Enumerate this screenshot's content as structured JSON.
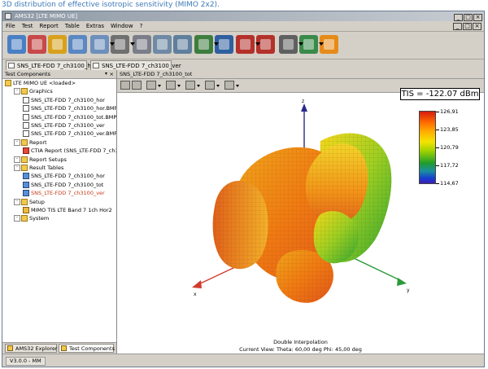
{
  "caption": "3D distribution of effective isotropic sensitivity (MIMO 2x2).",
  "window": {
    "title": "AMS32 [LTE MIMO UE]",
    "controls": [
      "_",
      "□",
      "×"
    ]
  },
  "menu": {
    "items": [
      "File",
      "Test",
      "Report",
      "Table",
      "Extras",
      "Window",
      "?"
    ]
  },
  "toolbar": {
    "buttons": [
      {
        "name": "new-icon",
        "color": "#4a7fc4"
      },
      {
        "name": "chart-icon",
        "color": "#c74949"
      },
      {
        "name": "report-icon",
        "color": "#d8a11c"
      },
      {
        "name": "table-icon",
        "color": "#5b87c2"
      },
      {
        "name": "edit-icon",
        "color": "#6d8fbc"
      },
      {
        "name": "print-icon",
        "color": "#707070"
      },
      {
        "name": "database-icon",
        "color": "#7b7e88"
      },
      {
        "name": "database-save-icon",
        "color": "#6f8aa5"
      },
      {
        "name": "database-refresh-icon",
        "color": "#5f7f9c"
      },
      {
        "name": "run-icon",
        "color": "#3e7d3e"
      },
      {
        "name": "stop-icon",
        "color": "#2f5f9f"
      },
      {
        "name": "record-icon",
        "color": "#b3312a"
      },
      {
        "name": "pause-icon",
        "color": "#b3312a"
      },
      {
        "name": "tools-icon",
        "color": "#606060"
      },
      {
        "name": "setup-icon",
        "color": "#3a8a4a"
      },
      {
        "name": "rss-icon",
        "color": "#e68a1a"
      }
    ]
  },
  "doc_tabs": [
    {
      "label": "SNS_LTE-FDD 7_ch3100_hor",
      "active": false
    },
    {
      "label": "SNS_LTE-FDD 7_ch3100_ver",
      "active": false
    }
  ],
  "left_panel": {
    "title": "Test Components",
    "pin": "▾",
    "close": "×",
    "tree": [
      {
        "label": "LTE MIMO UE <loaded>",
        "level": 0,
        "icon": "root"
      },
      {
        "label": "Graphics",
        "level": 1,
        "icon": "folder"
      },
      {
        "label": "SNS_LTE-FDD 7_ch3100_hor",
        "level": 2,
        "icon": "doc"
      },
      {
        "label": "SNS_LTE-FDD 7_ch3100_hor.BMP",
        "level": 2,
        "icon": "doc"
      },
      {
        "label": "SNS_LTE-FDD 7_ch3100_tot.BMP",
        "level": 2,
        "icon": "doc"
      },
      {
        "label": "SNS_LTE-FDD 7_ch3100_ver",
        "level": 2,
        "icon": "doc"
      },
      {
        "label": "SNS_LTE-FDD 7_ch3100_ver.BMP",
        "level": 2,
        "icon": "doc"
      },
      {
        "label": "Report",
        "level": 1,
        "icon": "folder"
      },
      {
        "label": "CTIA Report (SNS_LTE-FDD 7_ch31",
        "level": 2,
        "icon": "report"
      },
      {
        "label": "Report Setups",
        "level": 1,
        "icon": "folder"
      },
      {
        "label": "Result Tables",
        "level": 1,
        "icon": "folder"
      },
      {
        "label": "SNS_LTE-FDD 7_ch3100_hor",
        "level": 2,
        "icon": "table"
      },
      {
        "label": "SNS_LTE-FDD 7_ch3100_tot",
        "level": 2,
        "icon": "table"
      },
      {
        "label": "SNS_LTE-FDD 7_ch3100_ver",
        "level": 2,
        "icon": "table",
        "highlight": true
      },
      {
        "label": "Setup",
        "level": 1,
        "icon": "folder"
      },
      {
        "label": "MIMO TIS LTE Band 7 1ch Hor2",
        "level": 2,
        "icon": "setup"
      },
      {
        "label": "System",
        "level": 1,
        "icon": "folder"
      }
    ],
    "bottom_tabs": [
      {
        "label": "AMS32 Explorer",
        "active": false
      },
      {
        "label": "Test Components",
        "active": true
      }
    ]
  },
  "right_panel": {
    "tab_label": "SNS_LTE-FDD 7_ch3100_tot",
    "tis_readout": "TIS = -122.07 dBm",
    "axis_z": "z",
    "axis_x": "x",
    "axis_y": "y",
    "footer_title": "Double Interpolation",
    "current_view_label": "Current View:",
    "theta_text": "Theta: 60,00 deg",
    "phi_text": "Phi: 45,00 deg",
    "colorbar": {
      "labels": [
        "126,91",
        "123,85",
        "120,79",
        "117,72",
        "114,67"
      ],
      "top_color": "#d51d10",
      "bottom_color": "#3b1fb4"
    }
  },
  "status": {
    "text": "V3.0.0 - MM"
  }
}
